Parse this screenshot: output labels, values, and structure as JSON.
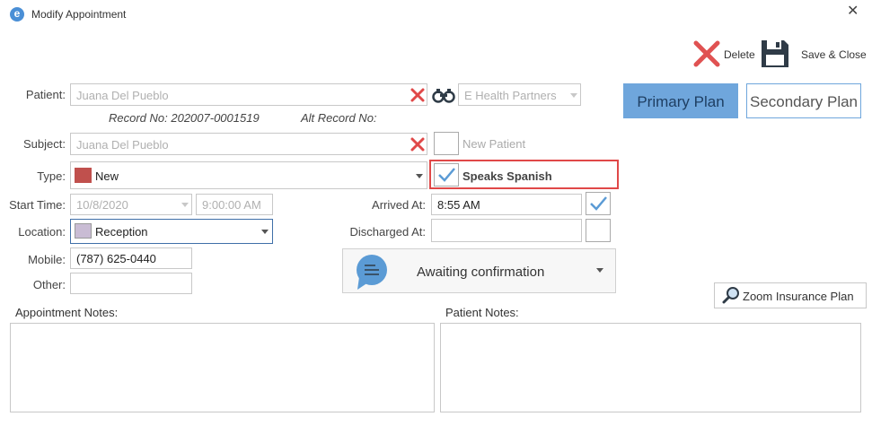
{
  "window": {
    "title": "Modify Appointment"
  },
  "toolbar": {
    "delete_label": "Delete",
    "save_close_label": "Save & Close"
  },
  "plans": {
    "primary_label": "Primary Plan",
    "secondary_label": "Secondary Plan"
  },
  "patient": {
    "label": "Patient:",
    "value": "Juana Del Pueblo",
    "record_no": "Record No: 202007-0001519",
    "alt_record_no": "Alt Record No:",
    "partner": "E Health Partners"
  },
  "subject": {
    "label": "Subject:",
    "value": "Juana Del Pueblo",
    "new_patient_label": "New Patient"
  },
  "type": {
    "label": "Type:",
    "value": "New",
    "color": "#c0504d",
    "speaks_spanish_label": "Speaks Spanish"
  },
  "start": {
    "label": "Start Time:",
    "date": "10/8/2020",
    "time": "9:00:00 AM"
  },
  "arrived": {
    "label": "Arrived At:",
    "value": "8:55 AM"
  },
  "location": {
    "label": "Location:",
    "value": "Reception",
    "color": "#c9bcd4"
  },
  "discharged": {
    "label": "Discharged At:",
    "value": ""
  },
  "mobile": {
    "label": "Mobile:",
    "value": "(787) 625-0440"
  },
  "other": {
    "label": "Other:",
    "value": ""
  },
  "status": {
    "value": "Awaiting confirmation",
    "icon_color": "#5b9bd5"
  },
  "zoom_insurance": {
    "label": "Zoom Insurance Plan"
  },
  "notes": {
    "appointment_label": "Appointment Notes:",
    "patient_label": "Patient Notes:"
  },
  "colors": {
    "accent": "#5b9bd5",
    "delete_red": "#e05252",
    "highlight_red": "#e04848"
  }
}
